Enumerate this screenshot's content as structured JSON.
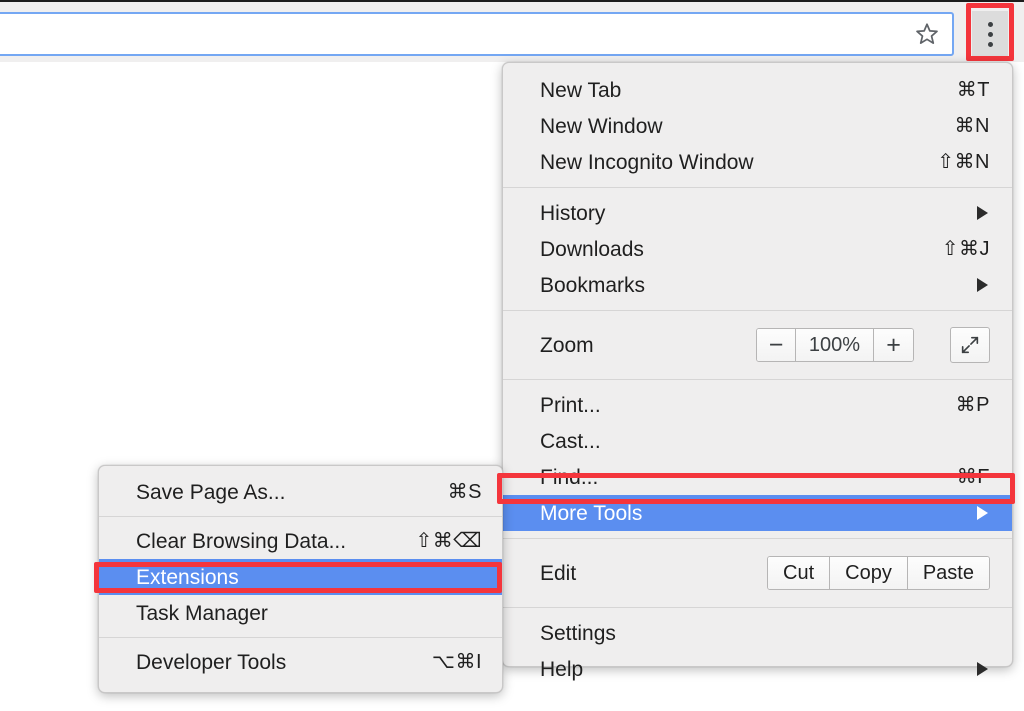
{
  "browser": {
    "omnibox": {
      "value": "",
      "placeholder": ""
    },
    "bookmark_icon": "star-icon",
    "menu_button": "three-dot-menu-icon"
  },
  "colors": {
    "highlight": "#5b8ef0",
    "annotation": "#f4353c",
    "menu_background": "#efeeee",
    "omnibox_focus_border": "#74a7f3"
  },
  "main_menu": {
    "groups": [
      {
        "items": [
          {
            "label": "New Tab",
            "accel": "⌘T",
            "arrow": false,
            "selected": false
          },
          {
            "label": "New Window",
            "accel": "⌘N",
            "arrow": false,
            "selected": false
          },
          {
            "label": "New Incognito Window",
            "accel": "⇧⌘N",
            "arrow": false,
            "selected": false
          }
        ]
      },
      {
        "items": [
          {
            "label": "History",
            "accel": "",
            "arrow": true,
            "selected": false
          },
          {
            "label": "Downloads",
            "accel": "⇧⌘J",
            "arrow": false,
            "selected": false
          },
          {
            "label": "Bookmarks",
            "accel": "",
            "arrow": true,
            "selected": false
          }
        ]
      },
      {
        "items": [
          {
            "label": "Zoom",
            "accel": "",
            "arrow": false,
            "selected": false,
            "control": "zoom"
          }
        ]
      },
      {
        "items": [
          {
            "label": "Print...",
            "accel": "⌘P",
            "arrow": false,
            "selected": false
          },
          {
            "label": "Cast...",
            "accel": "",
            "arrow": false,
            "selected": false
          },
          {
            "label": "Find...",
            "accel": "⌘F",
            "arrow": false,
            "selected": false
          },
          {
            "label": "More Tools",
            "accel": "",
            "arrow": true,
            "selected": true
          }
        ]
      },
      {
        "items": [
          {
            "label": "Edit",
            "accel": "",
            "arrow": false,
            "selected": false,
            "control": "edit"
          }
        ]
      },
      {
        "items": [
          {
            "label": "Settings",
            "accel": "",
            "arrow": false,
            "selected": false
          },
          {
            "label": "Help",
            "accel": "",
            "arrow": true,
            "selected": false
          }
        ]
      }
    ],
    "zoom_control": {
      "minus_label": "−",
      "value": "100%",
      "plus_label": "+",
      "fullscreen_icon": "fullscreen-expand-icon"
    },
    "edit_control": {
      "cut_label": "Cut",
      "copy_label": "Copy",
      "paste_label": "Paste"
    }
  },
  "sub_menu": {
    "groups": [
      {
        "items": [
          {
            "label": "Save Page As...",
            "accel": "⌘S",
            "selected": false
          }
        ]
      },
      {
        "items": [
          {
            "label": "Clear Browsing Data...",
            "accel": "⇧⌘⌫",
            "selected": false
          },
          {
            "label": "Extensions",
            "accel": "",
            "selected": true
          },
          {
            "label": "Task Manager",
            "accel": "",
            "selected": false
          }
        ]
      },
      {
        "items": [
          {
            "label": "Developer Tools",
            "accel": "⌥⌘I",
            "selected": false
          }
        ]
      }
    ]
  }
}
